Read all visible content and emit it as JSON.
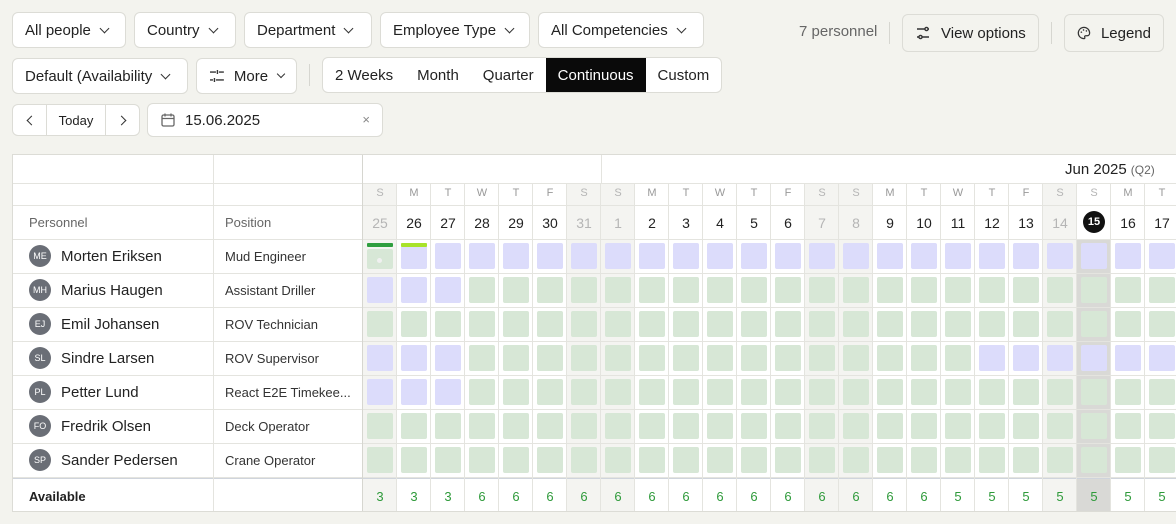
{
  "filters": [
    {
      "label": "All people"
    },
    {
      "label": "Country"
    },
    {
      "label": "Department"
    },
    {
      "label": "Employee Type"
    },
    {
      "label": "All Competencies"
    }
  ],
  "personnel_count": "7 personnel",
  "view_options_label": "View options",
  "legend_label": "Legend",
  "sort_label": "Default (Availability",
  "more_label": "More",
  "ranges": [
    {
      "label": "2 Weeks",
      "active": false
    },
    {
      "label": "Month",
      "active": false
    },
    {
      "label": "Quarter",
      "active": false
    },
    {
      "label": "Continuous",
      "active": true
    },
    {
      "label": "Custom",
      "active": false
    }
  ],
  "today_label": "Today",
  "date_value": "15.06.2025",
  "date_clear": "×",
  "month_label": "Jun 2025",
  "quarter_label": "(Q2)",
  "columns": {
    "personnel": "Personnel",
    "position": "Position"
  },
  "days": [
    {
      "l": "S",
      "n": "25",
      "we": true
    },
    {
      "l": "M",
      "n": "26",
      "we": false
    },
    {
      "l": "T",
      "n": "27",
      "we": false
    },
    {
      "l": "W",
      "n": "28",
      "we": false
    },
    {
      "l": "T",
      "n": "29",
      "we": false
    },
    {
      "l": "F",
      "n": "30",
      "we": false
    },
    {
      "l": "S",
      "n": "31",
      "we": true
    },
    {
      "l": "S",
      "n": "1",
      "we": true
    },
    {
      "l": "M",
      "n": "2",
      "we": false
    },
    {
      "l": "T",
      "n": "3",
      "we": false
    },
    {
      "l": "W",
      "n": "4",
      "we": false
    },
    {
      "l": "T",
      "n": "5",
      "we": false
    },
    {
      "l": "F",
      "n": "6",
      "we": false
    },
    {
      "l": "S",
      "n": "7",
      "we": true
    },
    {
      "l": "S",
      "n": "8",
      "we": true
    },
    {
      "l": "M",
      "n": "9",
      "we": false
    },
    {
      "l": "T",
      "n": "10",
      "we": false
    },
    {
      "l": "W",
      "n": "11",
      "we": false
    },
    {
      "l": "T",
      "n": "12",
      "we": false
    },
    {
      "l": "F",
      "n": "13",
      "we": false
    },
    {
      "l": "S",
      "n": "14",
      "we": true
    },
    {
      "l": "S",
      "n": "15",
      "we": true,
      "today": true
    },
    {
      "l": "M",
      "n": "16",
      "we": false
    },
    {
      "l": "T",
      "n": "17",
      "we": false
    }
  ],
  "people": [
    {
      "initials": "ME",
      "name": "Morten Eriksen",
      "position": "Mud Engineer",
      "cells": "xppppppppppppppppppppppp"
    },
    {
      "initials": "MH",
      "name": "Marius Haugen",
      "position": "Assistant Driller",
      "cells": "pppggggggggggggggggggggg"
    },
    {
      "initials": "EJ",
      "name": "Emil Johansen",
      "position": "ROV Technician",
      "cells": "gggggggggggggggggggggggg"
    },
    {
      "initials": "SL",
      "name": "Sindre Larsen",
      "position": "ROV Supervisor",
      "cells": "pppgggggggggggggggpppppp"
    },
    {
      "initials": "PL",
      "name": "Petter Lund",
      "position": "React E2E Timekee...",
      "cells": "pppggggggggggggggggggggg"
    },
    {
      "initials": "FO",
      "name": "Fredrik Olsen",
      "position": "Deck Operator",
      "cells": "gggggggggggggggggggggggg"
    },
    {
      "initials": "SP",
      "name": "Sander Pedersen",
      "position": "Crane Operator",
      "cells": "gggggggggggggggggggggggg"
    }
  ],
  "available_label": "Available",
  "available_values": [
    "3",
    "3",
    "3",
    "6",
    "6",
    "6",
    "6",
    "6",
    "6",
    "6",
    "6",
    "6",
    "6",
    "6",
    "6",
    "6",
    "6",
    "5",
    "5",
    "5",
    "5",
    "5",
    "5",
    "5"
  ],
  "colors": {
    "accent": "#0a0a0a",
    "available_green": "#2e9a3a",
    "cell_green": "#d7e7d6",
    "cell_purple": "#dcdcfb",
    "marker_green": "#2f9e3f",
    "marker_lime": "#a8e32a"
  }
}
